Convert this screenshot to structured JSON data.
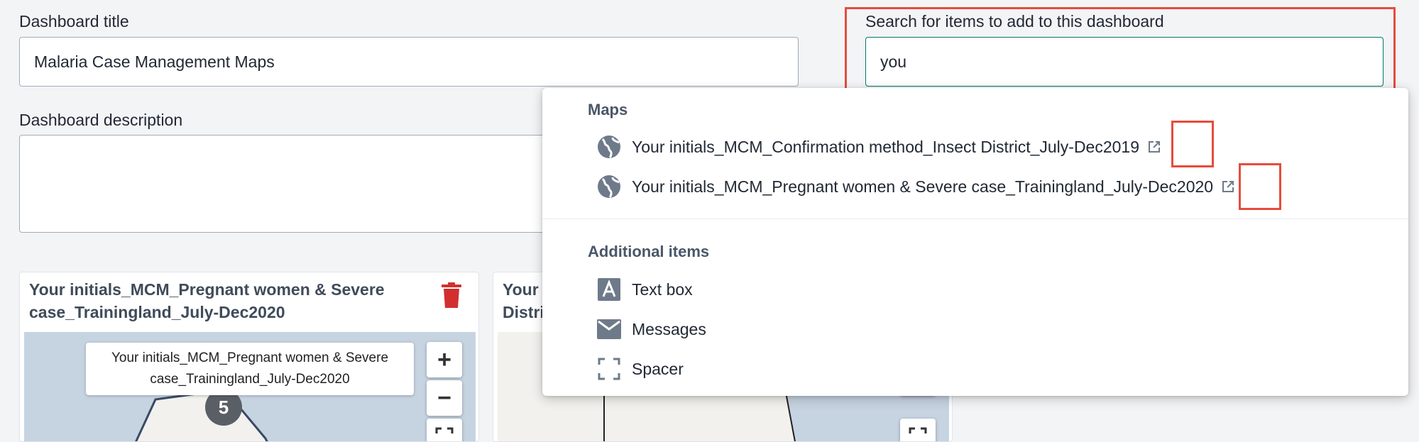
{
  "form": {
    "title_label": "Dashboard title",
    "title_value": "Malaria Case Management Maps",
    "description_label": "Dashboard description",
    "description_value": "",
    "search_label": "Search for items to add to this dashboard",
    "search_value": "you"
  },
  "cards": [
    {
      "title_line1": "Your initials_MCM_Pregnant women & Severe",
      "title_line2": "case_Trainingland_July-Dec2020",
      "tooltip_line1": "Your initials_MCM_Pregnant women & Severe",
      "tooltip_line2": "case_Trainingland_July-Dec2020",
      "cluster_count": "5",
      "zoom_in": "+",
      "zoom_out": "−"
    },
    {
      "title_line1": "Your",
      "title_line2": "Distri",
      "zoom_out": "−"
    }
  ],
  "dropdown": {
    "maps_section": "Maps",
    "maps": [
      {
        "label": "Your initials_MCM_Confirmation method_Insect District_July-Dec2019",
        "icon": "globe-icon"
      },
      {
        "label": "Your initials_MCM_Pregnant women & Severe case_Trainingland_July-Dec2020",
        "icon": "globe-icon"
      }
    ],
    "additional_section": "Additional items",
    "additional": [
      {
        "label": "Text box",
        "icon": "text-box-icon"
      },
      {
        "label": "Messages",
        "icon": "mail-icon"
      },
      {
        "label": "Spacer",
        "icon": "spacer-icon"
      }
    ]
  },
  "colors": {
    "highlight": "#e74c3c",
    "delete": "#d32f2f",
    "focus_border": "#00796b",
    "map_water": "#c6d3e1"
  }
}
